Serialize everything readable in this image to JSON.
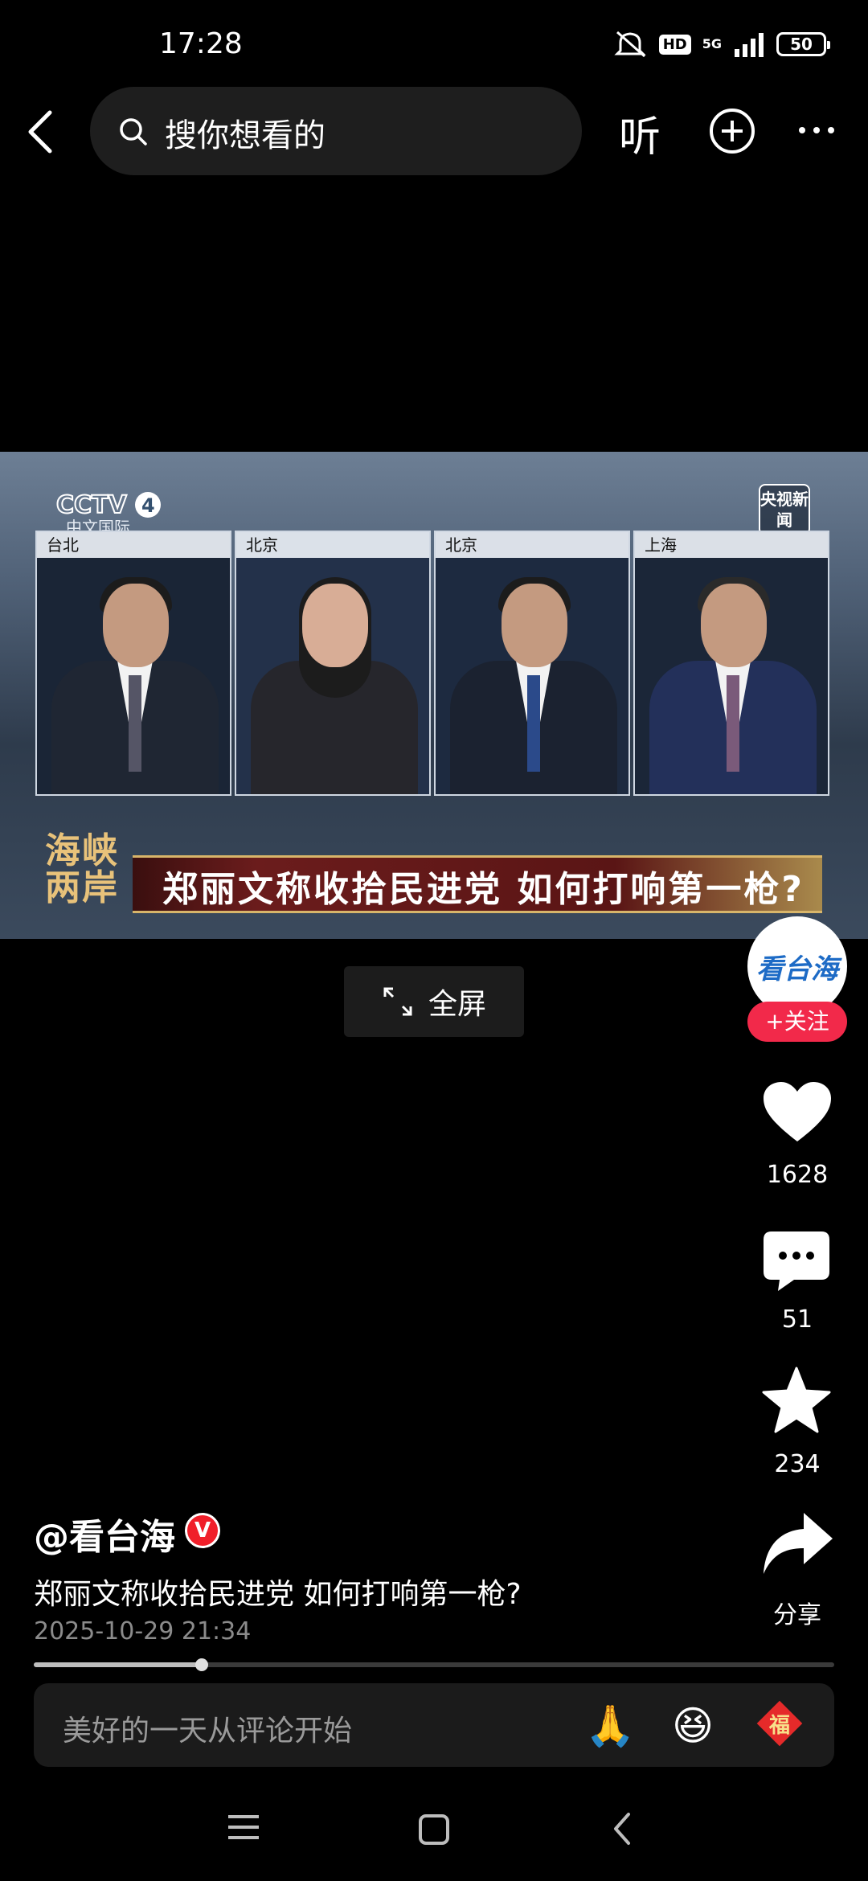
{
  "status_bar": {
    "time": "17:28",
    "network": "5G",
    "hd": "HD",
    "battery": "50"
  },
  "header": {
    "search_placeholder": "搜你想看的",
    "listen_label": "听"
  },
  "video": {
    "channel_logo": "CCTV 4",
    "channel_sub": "中文国际",
    "news_logo": "央视新闻",
    "panels": [
      "台北",
      "北京",
      "北京",
      "上海"
    ],
    "program_logo": "海峡两岸",
    "headline": "郑丽文称收拾民进党 如何打响第一枪?"
  },
  "fullscreen": {
    "label": "全屏"
  },
  "author": {
    "avatar_text": "看台海",
    "follow_label": "+关注",
    "handle": "@看台海",
    "verified_mark": "V"
  },
  "actions": {
    "likes": "1628",
    "comments": "51",
    "favorites": "234",
    "share_label": "分享"
  },
  "post": {
    "title": "郑丽文称收拾民进党 如何打响第一枪?",
    "date": "2025-10-29 21:34",
    "progress": 0.21
  },
  "comment_bar": {
    "placeholder": "美好的一天从评论开始",
    "emoji_pray": "🙏",
    "emoji_laugh": "😆",
    "emoji_fu": "福"
  }
}
